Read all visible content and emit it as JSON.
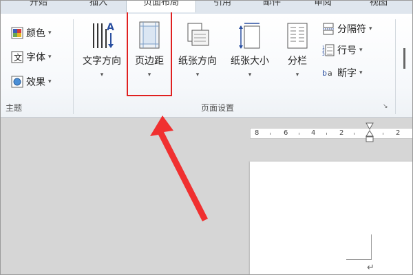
{
  "tabs": [
    {
      "label": "开始",
      "active": false
    },
    {
      "label": "插入",
      "active": false
    },
    {
      "label": "页面布局",
      "active": true
    },
    {
      "label": "引用",
      "active": false
    },
    {
      "label": "邮件",
      "active": false
    },
    {
      "label": "审阅",
      "active": false
    },
    {
      "label": "视图",
      "active": false
    }
  ],
  "theme_group": {
    "label": "主题",
    "items": [
      {
        "label": "颜色",
        "icon": "colors-icon"
      },
      {
        "label": "字体",
        "icon": "fonts-icon"
      },
      {
        "label": "效果",
        "icon": "effects-icon"
      }
    ]
  },
  "page_setup_group": {
    "label": "页面设置",
    "big_buttons": [
      {
        "label": "文字方向",
        "icon": "text-direction-icon"
      },
      {
        "label": "页边距",
        "icon": "margins-icon",
        "highlighted": true
      },
      {
        "label": "纸张方向",
        "icon": "orientation-icon"
      },
      {
        "label": "纸张大小",
        "icon": "size-icon"
      },
      {
        "label": "分栏",
        "icon": "columns-icon"
      }
    ],
    "small_buttons": [
      {
        "label": "分隔符",
        "icon": "breaks-icon"
      },
      {
        "label": "行号",
        "icon": "line-numbers-icon"
      },
      {
        "label": "断字",
        "icon": "hyphenation-icon"
      }
    ]
  },
  "ruler": {
    "numbers": [
      "8",
      "6",
      "4",
      "2",
      "",
      "2"
    ]
  },
  "page": {
    "paragraph_mark": "↵"
  },
  "colors": {
    "highlight": "#e02020",
    "arrow": "#f03030"
  }
}
